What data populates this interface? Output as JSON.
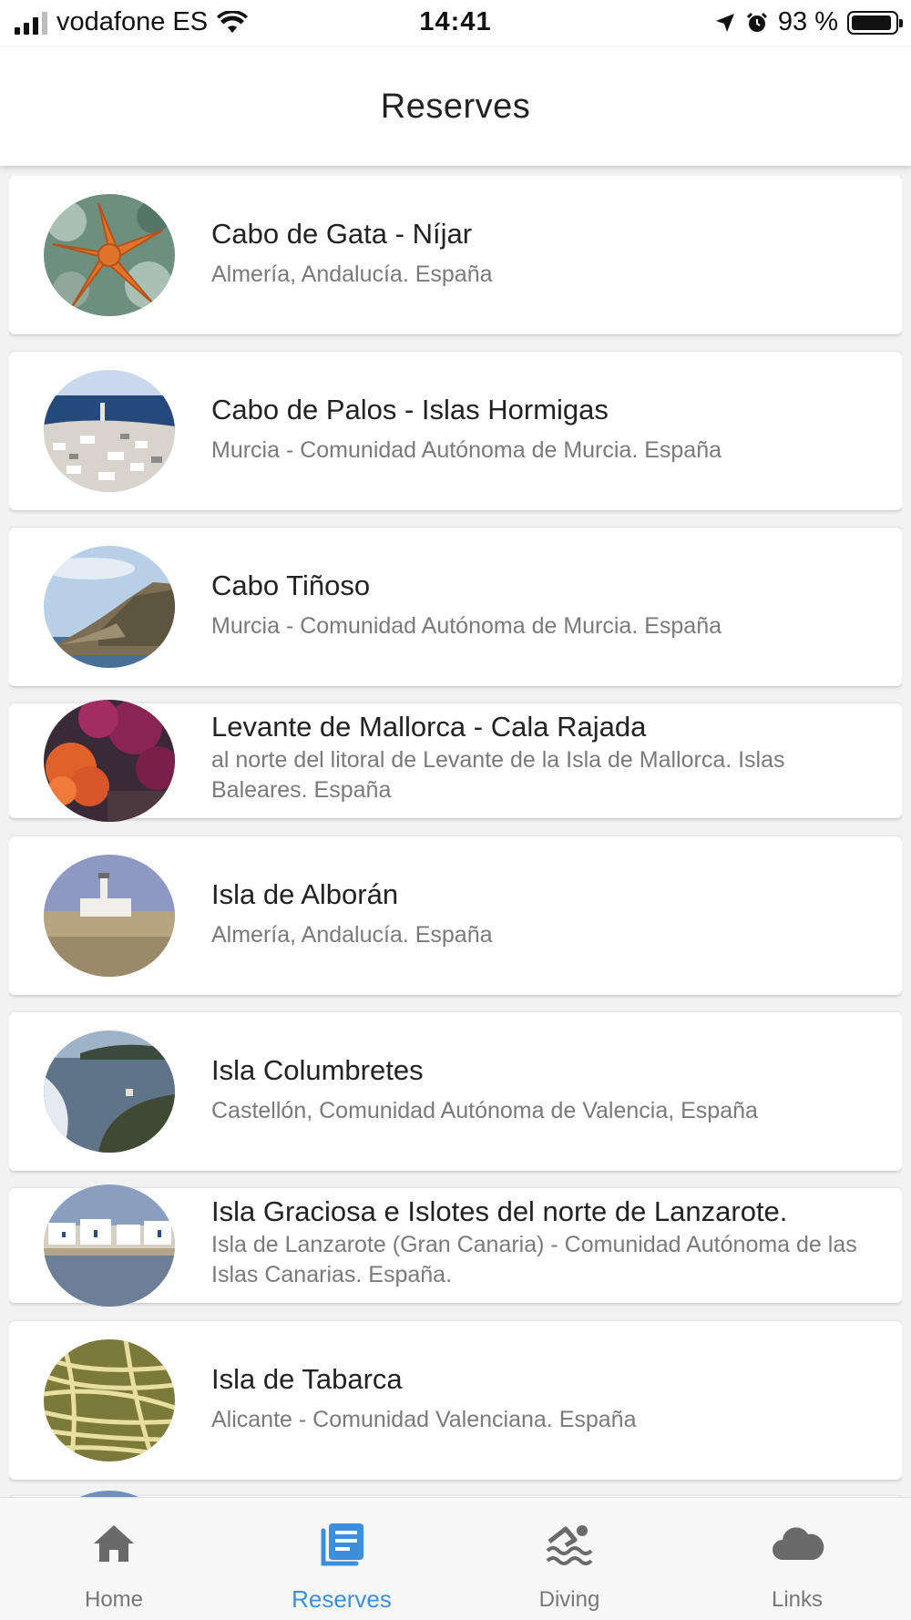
{
  "status_bar": {
    "carrier": "vodafone ES",
    "time": "14:41",
    "battery": "93 %",
    "battery_level": 0.93,
    "signal_bars": 3
  },
  "header": {
    "title": "Reserves"
  },
  "reserves": [
    {
      "title": "Cabo de Gata - Níjar",
      "subtitle": "Almería, Andalucía. España",
      "image": "orange-starfish"
    },
    {
      "title": "Cabo de Palos - Islas Hormigas",
      "subtitle": "Murcia - Comunidad Autónoma de Murcia. España",
      "image": "coastal-town"
    },
    {
      "title": "Cabo Tiñoso",
      "subtitle": "Murcia - Comunidad Autónoma de Murcia. España",
      "image": "sea-cliff"
    },
    {
      "title": "Levante de Mallorca - Cala Rajada",
      "subtitle": "al norte del litoral de Levante de la Isla de Mallorca. Islas Baleares. España",
      "image": "red-coral"
    },
    {
      "title": "Isla de Alborán",
      "subtitle": "Almería, Andalucía. España",
      "image": "lighthouse-island"
    },
    {
      "title": "Isla Columbretes",
      "subtitle": "Castellón, Comunidad Autónoma de Valencia, España",
      "image": "volcanic-islet"
    },
    {
      "title": "Isla Graciosa e Islotes del norte de Lanzarote.",
      "subtitle": "Isla de Lanzarote (Gran Canaria) - Comunidad Autónoma de las Islas Canarias. España.",
      "image": "white-village"
    },
    {
      "title": "Isla de Tabarca",
      "subtitle": "Alicante - Comunidad Valenciana. España",
      "image": "seagrass"
    }
  ],
  "tabs": [
    {
      "label": "Home",
      "icon": "home-icon",
      "active": false
    },
    {
      "label": "Reserves",
      "icon": "book-icon",
      "active": true
    },
    {
      "label": "Diving",
      "icon": "swimmer-icon",
      "active": false
    },
    {
      "label": "Links",
      "icon": "cloud-icon",
      "active": false
    }
  ],
  "colors": {
    "accent": "#3d8fdc",
    "inactive": "#777777"
  }
}
